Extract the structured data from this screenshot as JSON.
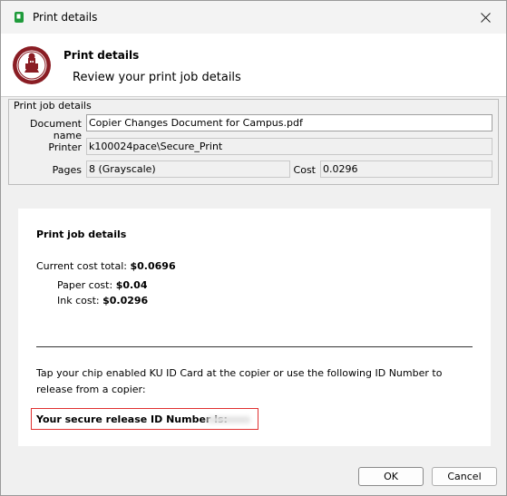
{
  "window": {
    "title": "Print details",
    "icon": "app-badge-icon",
    "accent": "#1f9b3b"
  },
  "header": {
    "title": "Print details",
    "subtitle": "Review your print job details"
  },
  "job_group": {
    "legend": "Print job details",
    "document_label": "Document name",
    "document_value": "Copier Changes Document for Campus.pdf",
    "printer_label": "Printer",
    "printer_value": "k100024pace\\Secure_Print",
    "pages_label": "Pages",
    "pages_value": "8   (Grayscale)",
    "cost_label": "Cost",
    "cost_value": "0.0296"
  },
  "summary": {
    "title": "Print job details",
    "total_label": "Current cost total: ",
    "total_value": "$0.0696",
    "paper_label": "Paper cost: ",
    "paper_value": "$0.04",
    "ink_label": "Ink cost: ",
    "ink_value": "$0.0296",
    "instructions": "Tap your chip enabled KU ID Card at the copier or use the following ID Number to release from a copier:",
    "release_label": "Your secure release ID Number is: ",
    "highlight_color": "#e03030"
  },
  "buttons": {
    "ok": "OK",
    "cancel": "Cancel"
  }
}
